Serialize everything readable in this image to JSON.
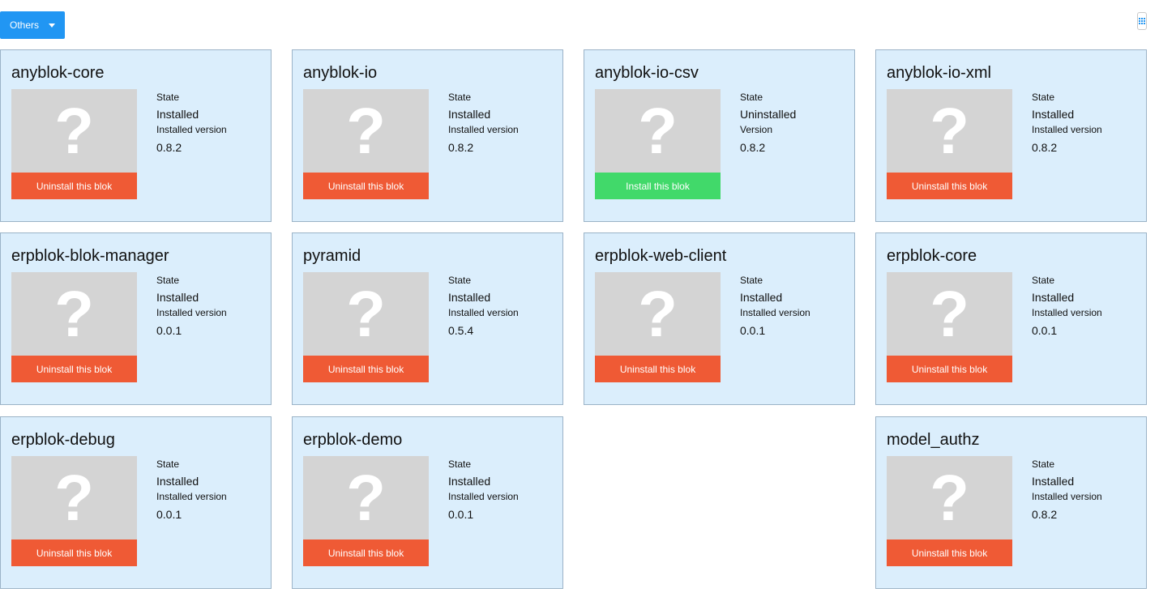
{
  "toolbar": {
    "filter_label": "Others"
  },
  "bloks": [
    {
      "name": "anyblok-core",
      "state_label": "State",
      "state": "Installed",
      "version_label": "Installed version",
      "version": "0.8.2",
      "action": "Uninstall this blok",
      "action_type": "uninstall"
    },
    {
      "name": "anyblok-io",
      "state_label": "State",
      "state": "Installed",
      "version_label": "Installed version",
      "version": "0.8.2",
      "action": "Uninstall this blok",
      "action_type": "uninstall"
    },
    {
      "name": "anyblok-io-csv",
      "state_label": "State",
      "state": "Uninstalled",
      "version_label": "Version",
      "version": "0.8.2",
      "action": "Install this blok",
      "action_type": "install"
    },
    {
      "name": "anyblok-io-xml",
      "state_label": "State",
      "state": "Installed",
      "version_label": "Installed version",
      "version": "0.8.2",
      "action": "Uninstall this blok",
      "action_type": "uninstall"
    },
    {
      "name": "erpblok-blok-manager",
      "state_label": "State",
      "state": "Installed",
      "version_label": "Installed version",
      "version": "0.0.1",
      "action": "Uninstall this blok",
      "action_type": "uninstall"
    },
    {
      "name": "pyramid",
      "state_label": "State",
      "state": "Installed",
      "version_label": "Installed version",
      "version": "0.5.4",
      "action": "Uninstall this blok",
      "action_type": "uninstall"
    },
    {
      "name": "erpblok-web-client",
      "state_label": "State",
      "state": "Installed",
      "version_label": "Installed version",
      "version": "0.0.1",
      "action": "Uninstall this blok",
      "action_type": "uninstall"
    },
    {
      "name": "erpblok-core",
      "state_label": "State",
      "state": "Installed",
      "version_label": "Installed version",
      "version": "0.0.1",
      "action": "Uninstall this blok",
      "action_type": "uninstall"
    },
    {
      "name": "erpblok-debug",
      "state_label": "State",
      "state": "Installed",
      "version_label": "Installed version",
      "version": "0.0.1",
      "action": "Uninstall this blok",
      "action_type": "uninstall"
    },
    {
      "name": "erpblok-demo",
      "state_label": "State",
      "state": "Installed",
      "version_label": "Installed version",
      "version": "0.0.1",
      "action": "Uninstall this blok",
      "action_type": "uninstall"
    },
    {
      "name": "model_authz",
      "state_label": "State",
      "state": "Installed",
      "version_label": "Installed version",
      "version": "0.8.2",
      "action": "Uninstall this blok",
      "action_type": "uninstall"
    }
  ],
  "placeholder_glyph": "?",
  "icons": {
    "filter_caret": "caret-down-icon",
    "view_toggle": "grid-view-icon"
  },
  "colors": {
    "primary": "#2196f3",
    "card_bg": "#dbeefc",
    "uninstall": "#ef5a35",
    "install": "#41d96a",
    "thumb": "#d4d4d4"
  }
}
